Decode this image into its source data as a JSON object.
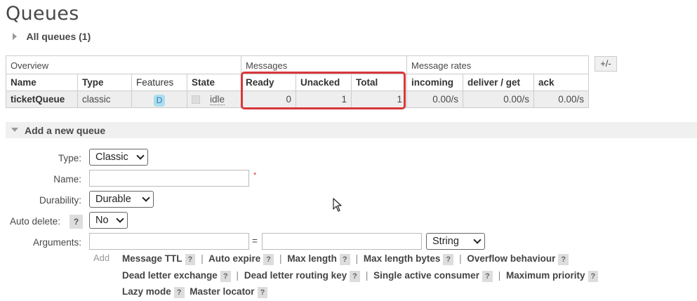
{
  "page": {
    "title": "Queues"
  },
  "all_queues": {
    "label": "All queues (1)"
  },
  "table": {
    "group_headers": [
      "Overview",
      "Messages",
      "Message rates"
    ],
    "columns": [
      "Name",
      "Type",
      "Features",
      "State",
      "Ready",
      "Unacked",
      "Total",
      "incoming",
      "deliver / get",
      "ack"
    ],
    "plus_minus": "+/-",
    "rows": [
      {
        "name": "ticketQueue",
        "type": "classic",
        "feature": "D",
        "state": "idle",
        "ready": "0",
        "unacked": "1",
        "total": "1",
        "incoming": "0.00/s",
        "deliver_get": "0.00/s",
        "ack": "0.00/s"
      }
    ]
  },
  "add_queue": {
    "header": "Add a new queue",
    "type_label": "Type:",
    "type_value": "Classic",
    "name_label": "Name:",
    "name_required": "*",
    "durability_label": "Durability:",
    "durability_value": "Durable",
    "auto_delete_label": "Auto delete:",
    "auto_delete_help": "?",
    "auto_delete_value": "No",
    "arguments_label": "Arguments:",
    "equals": "=",
    "arg_type_value": "String",
    "add_label": "Add",
    "shortcut_line1": [
      "Message TTL",
      "Auto expire",
      "Max length",
      "Max length bytes",
      "Overflow behaviour"
    ],
    "shortcut_line2": [
      "Dead letter exchange",
      "Dead letter routing key",
      "Single active consumer",
      "Maximum priority"
    ],
    "shortcut_line3": [
      "Lazy mode",
      "Master locator"
    ],
    "help": "?",
    "separator": "|"
  },
  "colors": {
    "highlight": "#d9373b",
    "feature_badge": "#aaddee"
  }
}
